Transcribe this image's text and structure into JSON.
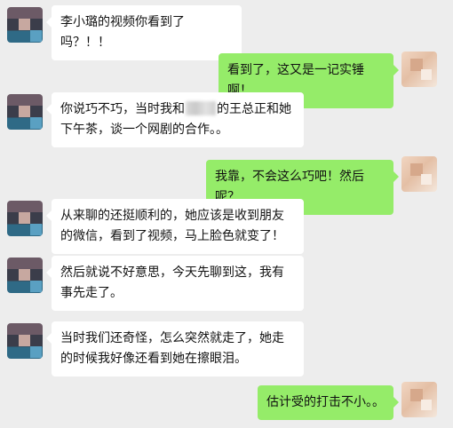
{
  "chat": {
    "messages": [
      {
        "side": "left",
        "text": "李小璐的视频你看到了吗？！！"
      },
      {
        "side": "right",
        "text": "看到了，这又是一记实锤啊！"
      },
      {
        "side": "left",
        "text_before": "你说巧不巧，当时我和",
        "text_after": "的王总正和她下午茶，谈一个网剧的合作。。"
      },
      {
        "side": "right",
        "text": "我靠，不会这么巧吧！然后呢？"
      },
      {
        "side": "left",
        "text": "从来聊的还挺顺利的，她应该是收到朋友的微信，看到了视频，马上脸色就变了！"
      },
      {
        "side": "left",
        "text": "然后就说不好意思，今天先聊到这，我有事先走了。"
      },
      {
        "side": "left",
        "text": "当时我们还奇怪，怎么突然就走了，她走的时候我好像还看到她在擦眼泪。"
      },
      {
        "side": "right",
        "text": "估计受的打击不小。。"
      }
    ]
  },
  "colors": {
    "background": "#ededed",
    "bubble_left": "#ffffff",
    "bubble_right": "#95ec69"
  }
}
